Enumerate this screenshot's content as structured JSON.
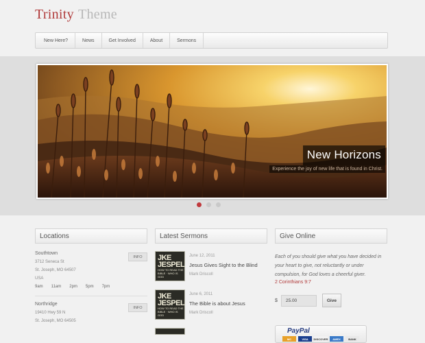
{
  "site": {
    "title_part1": "Trinity",
    "title_part2": "Theme"
  },
  "nav": {
    "items": [
      "New Here?",
      "News",
      "Get Involved",
      "About",
      "Sermons"
    ]
  },
  "slider": {
    "caption_title": "New Horizons",
    "caption_subtitle": "Experience the joy of new life that is found in Christ.",
    "dots": 3,
    "active_dot": 1
  },
  "locations": {
    "heading": "Locations",
    "info_label": "INFO",
    "items": [
      {
        "name": "Southtown",
        "address1": "3712 Seneca St",
        "address2": "St. Joseph, MO 64507",
        "country": "USA",
        "times": [
          "9am",
          "11am",
          "2pm",
          "5pm",
          "7pm"
        ]
      },
      {
        "name": "Northridge",
        "address1": "19410 Hwy 59 N",
        "address2": "St. Joseph, MO 64505"
      }
    ]
  },
  "sermons": {
    "heading": "Latest Sermons",
    "items": [
      {
        "date": "June 12, 2011",
        "title": "Jesus Gives Sight to the Blind",
        "author": "Mark Driscoll",
        "thumb_big": "JKE JESPEL",
        "thumb_small": "HOW TO READ THE BIBLE · WHO IS GOD"
      },
      {
        "date": "June 6, 2011",
        "title": "The Bible is about Jesus",
        "author": "Mark Driscoll",
        "thumb_big": "JKE JESPEL",
        "thumb_small": "HOW TO READ THE BIBLE · WHO IS GOD"
      }
    ]
  },
  "give": {
    "heading": "Give Online",
    "text": "Each of you should give what you have decided in your heart to give, not reluctantly or under compulsion, for God loves a cheerful giver.",
    "reference": "2 Corinthians 9:7",
    "currency": "$",
    "amount": "25.00",
    "button": "Give",
    "paypal_label": "PayPal",
    "cards": [
      "MC",
      "VISA",
      "DISCOVER",
      "AMEX",
      "BANK"
    ]
  },
  "colors": {
    "accent": "#b03a3a",
    "dot_active": "#c0393d"
  }
}
